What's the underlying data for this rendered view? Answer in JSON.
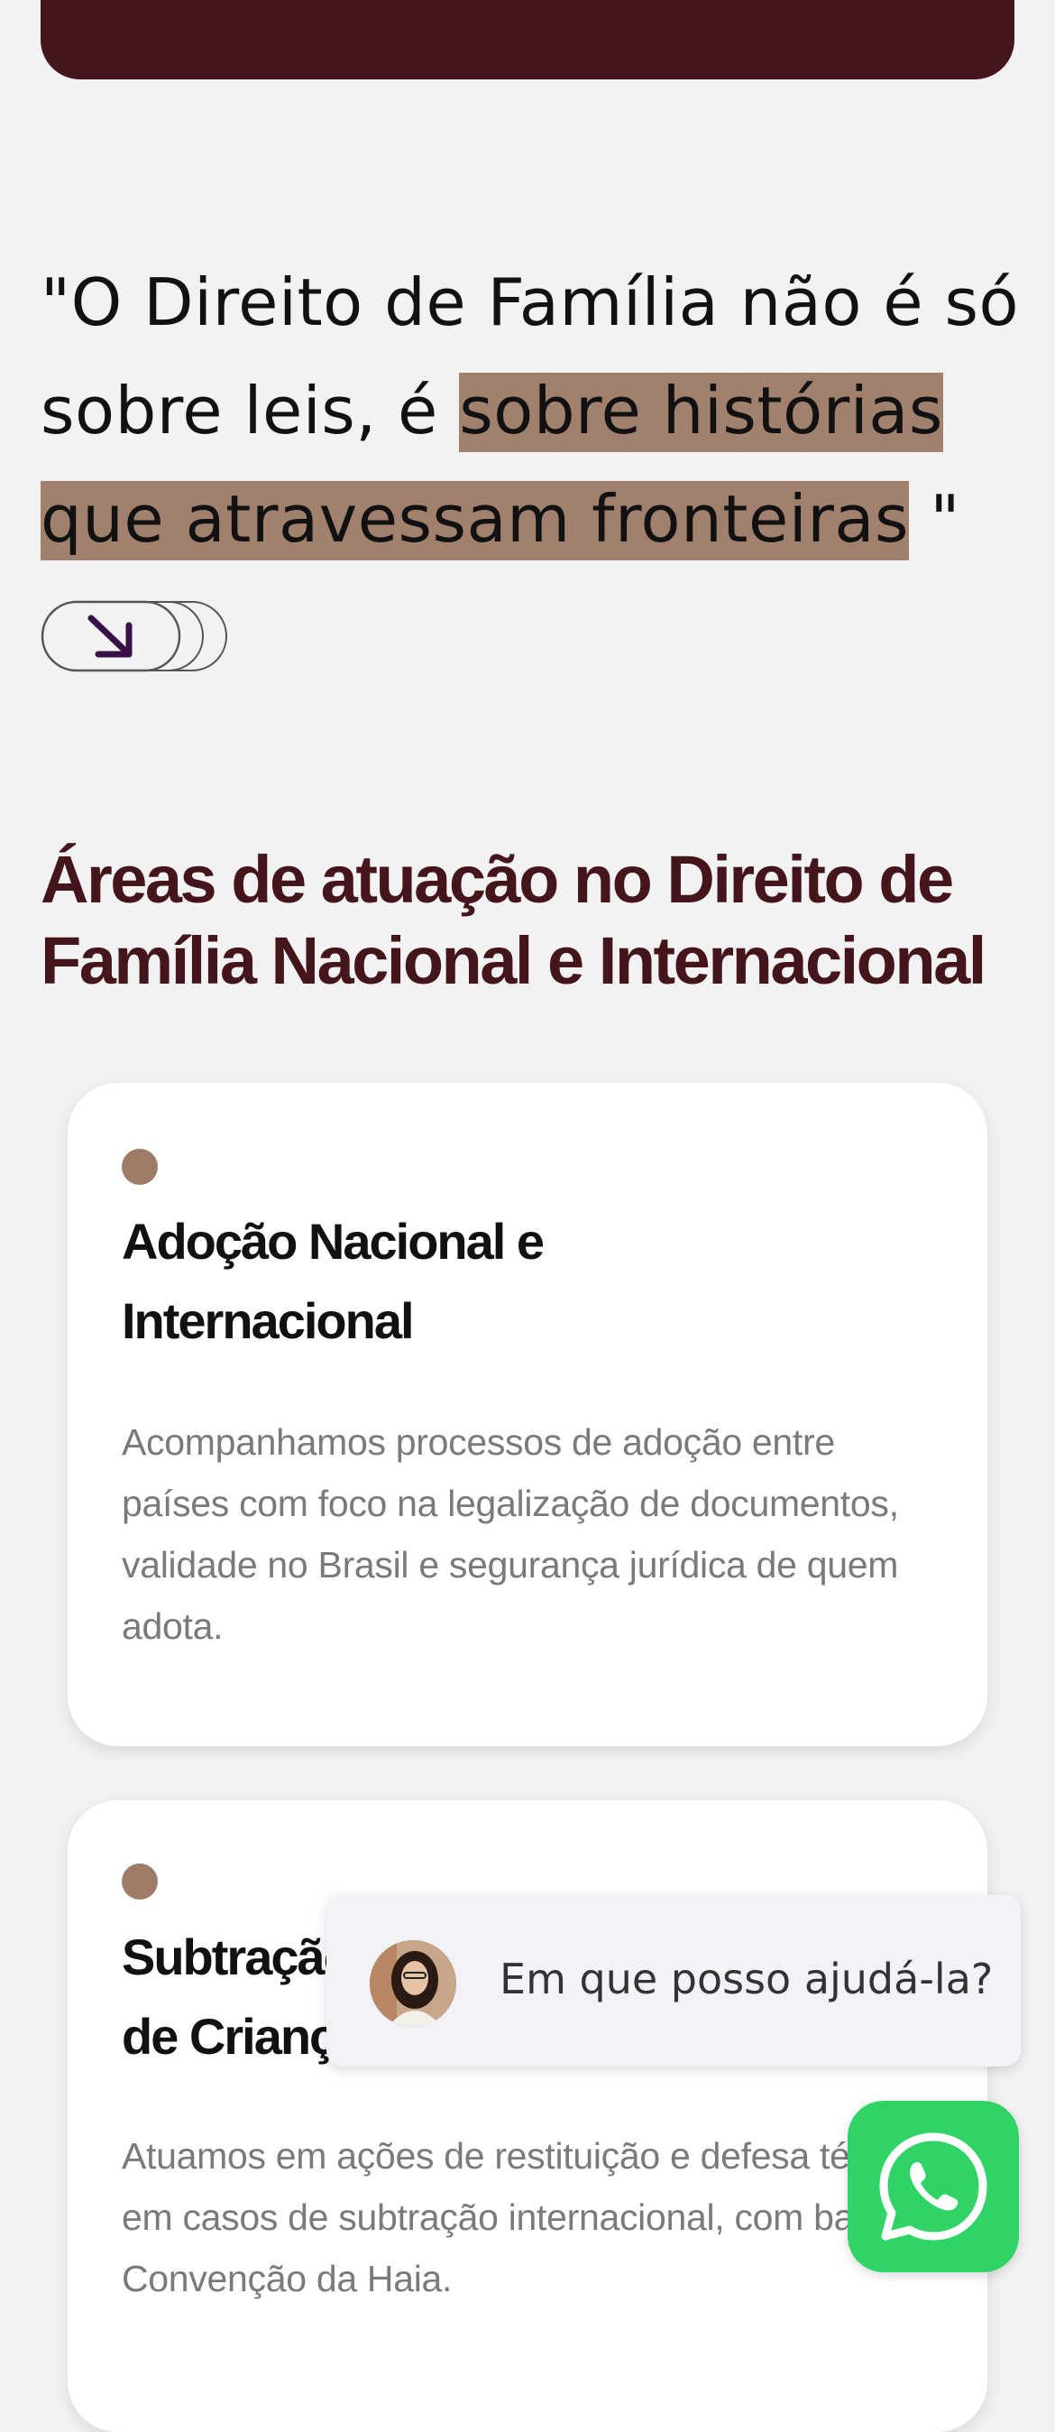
{
  "quote": {
    "open": "\"O Direito de Família não é só sobre leis, é ",
    "highlight": "sobre histórias que atravessam fronteiras",
    "close": " \""
  },
  "section": {
    "title": "Áreas de atuação no Direito de Família Nacional e Internacional"
  },
  "cards": [
    {
      "title": "Adoção Nacional e Internacional",
      "description": "Acompanhamos processos de adoção entre países com foco na legalização de documentos, validade no Brasil e segurança jurídica de quem adota."
    },
    {
      "title": "Subtração Internacional de Crianças",
      "description": "Atuamos em ações de restituição e defesa técnica em casos de subtração internacional, com base na Convenção da Haia."
    }
  ],
  "chat": {
    "message": "Em que posso ajudá-la?"
  },
  "colors": {
    "brand_dark": "#45151c",
    "highlight": "#a1806d",
    "dot": "#9f7a67",
    "whatsapp": "#2fd366"
  },
  "icons": {
    "scroll": "arrow-down-right-icon",
    "whatsapp": "whatsapp-icon"
  }
}
